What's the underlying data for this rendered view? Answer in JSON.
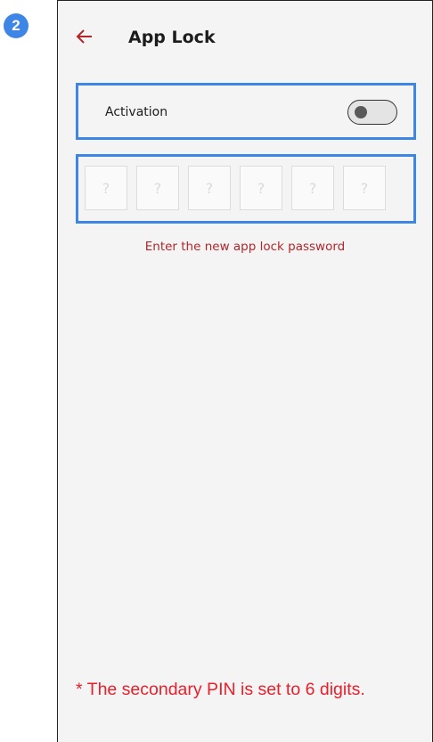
{
  "step_badge": "2",
  "header": {
    "title": "App Lock",
    "back_icon": "arrow-left-icon",
    "accent_color": "#b3262b"
  },
  "activation": {
    "label": "Activation",
    "toggle_on": false
  },
  "pin": {
    "placeholders": [
      "?",
      "?",
      "?",
      "?",
      "?",
      "?"
    ]
  },
  "hint": "Enter the new app lock password",
  "footnote": "* The secondary PIN is set to 6 digits.",
  "colors": {
    "highlight": "#3d86e6",
    "hint": "#b3262b",
    "footnote": "#e8202c"
  }
}
